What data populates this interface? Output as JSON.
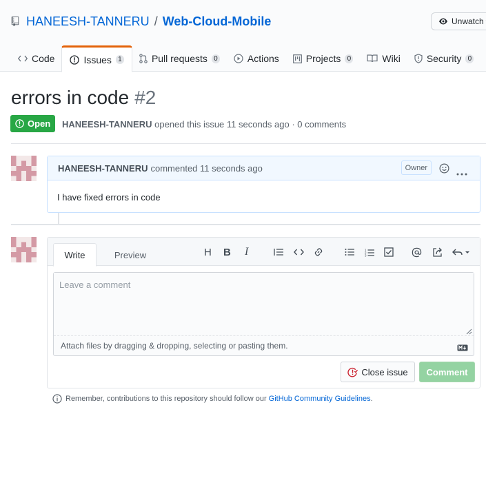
{
  "repo": {
    "owner": "HANEESH-TANNERU",
    "separator": "/",
    "name": "Web-Cloud-Mobile",
    "watch_label": "Unwatch"
  },
  "tabs": [
    {
      "label": "Code",
      "icon": "code-icon"
    },
    {
      "label": "Issues",
      "count": "1",
      "icon": "issue-opened-icon",
      "selected": true
    },
    {
      "label": "Pull requests",
      "count": "0",
      "icon": "git-pull-request-icon"
    },
    {
      "label": "Actions",
      "icon": "play-icon"
    },
    {
      "label": "Projects",
      "count": "0",
      "icon": "project-icon"
    },
    {
      "label": "Wiki",
      "icon": "book-icon"
    },
    {
      "label": "Security",
      "count": "0",
      "icon": "shield-icon"
    }
  ],
  "issue": {
    "title": "errors in code",
    "number": "#2",
    "state": "Open",
    "author": "HANEESH-TANNERU",
    "meta_text": "opened this issue 11 seconds ago · 0 comments"
  },
  "comment": {
    "author": "HANEESH-TANNERU",
    "action_text": "commented 11 seconds ago",
    "badge": "Owner",
    "body": "I have fixed errors in code"
  },
  "new_comment": {
    "tab_write": "Write",
    "tab_preview": "Preview",
    "placeholder": "Leave a comment",
    "attach_text": "Attach files by dragging & dropping, selecting or pasting them.",
    "close_label": "Close issue",
    "comment_label": "Comment",
    "toolbar": [
      "H",
      "B",
      "I",
      "quote",
      "code",
      "link",
      "unordered-list",
      "ordered-list",
      "task-list",
      "mention",
      "reference",
      "reply"
    ]
  },
  "footer": {
    "text": "Remember, contributions to this repository should follow our",
    "link": "GitHub Community Guidelines",
    "suffix": "."
  },
  "colors": {
    "accent_tab": "#e36209",
    "open_green": "#28a745",
    "link_blue": "#0366d6",
    "comment_header": "#f1f8ff"
  }
}
